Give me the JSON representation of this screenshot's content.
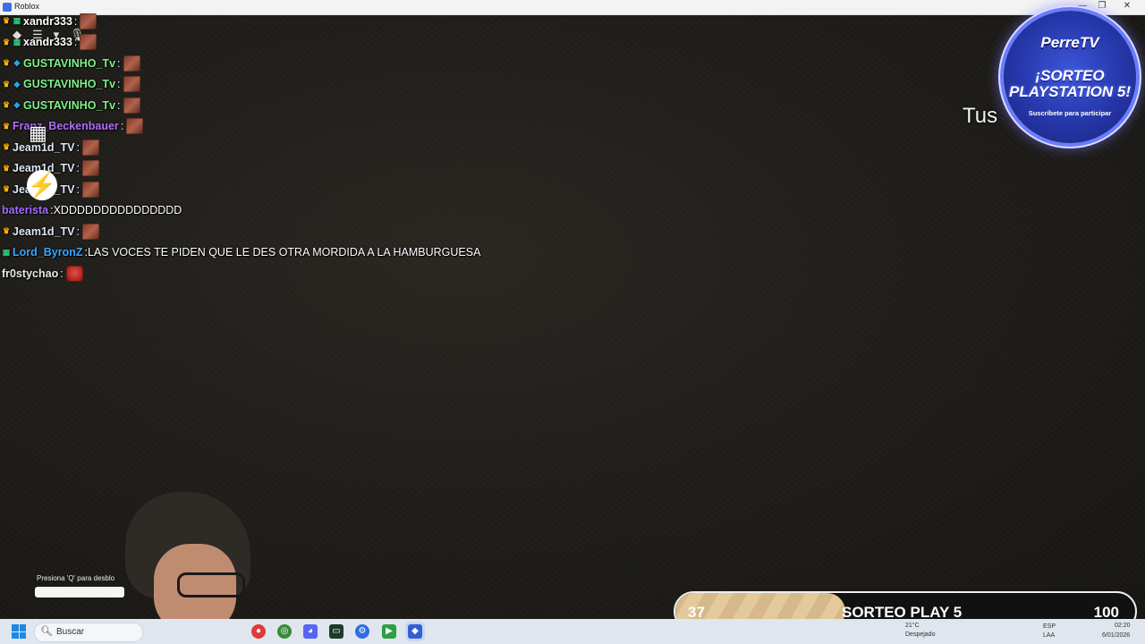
{
  "window": {
    "title": "Roblox",
    "controls": [
      "—",
      "❐",
      "✕"
    ]
  },
  "chat": {
    "messages": [
      {
        "user": "xandr333",
        "color": "#ffffff",
        "badges": [
          "crown",
          "grid"
        ],
        "text": "",
        "emote": "brown"
      },
      {
        "user": "xandr333",
        "color": "#ffffff",
        "badges": [
          "crown",
          "grid"
        ],
        "text": "",
        "emote": "brown"
      },
      {
        "user": "GUSTAVINHO_Tv",
        "color": "#7ef08a",
        "badges": [
          "crown",
          "gem"
        ],
        "text": "",
        "emote": "brown"
      },
      {
        "user": "GUSTAVINHO_Tv",
        "color": "#7ef08a",
        "badges": [
          "crown",
          "gem"
        ],
        "text": "",
        "emote": "brown"
      },
      {
        "user": "GUSTAVINHO_Tv",
        "color": "#7ef08a",
        "badges": [
          "crown",
          "gem"
        ],
        "text": "",
        "emote": "brown"
      },
      {
        "user": "Franz_Beckenbauer",
        "color": "#b46cff",
        "badges": [
          "crown"
        ],
        "text": "",
        "emote": "brown"
      },
      {
        "user": "Jeam1d_TV",
        "color": "#dce6f5",
        "badges": [
          "crown"
        ],
        "text": "",
        "emote": "brown"
      },
      {
        "user": "Jeam1d_TV",
        "color": "#dce6f5",
        "badges": [
          "crown"
        ],
        "text": "",
        "emote": "brown"
      },
      {
        "user": "Jeam1d_TV",
        "color": "#dce6f5",
        "badges": [
          "crown"
        ],
        "text": "",
        "emote": "brown"
      },
      {
        "user": "baterista",
        "color": "#a56bff",
        "badges": [],
        "text": "XDDDDDDDDDDDDDDD",
        "emote": ""
      },
      {
        "user": "Jeam1d_TV",
        "color": "#dce6f5",
        "badges": [
          "crown"
        ],
        "text": "",
        "emote": "brown"
      },
      {
        "user": "Lord_ByronZ",
        "color": "#3aa7ff",
        "badges": [
          "grid"
        ],
        "text": "LAS VOCES TE PIDEN QUE LE DES OTRA MORDIDA A LA HAMBURGUESA",
        "emote": ""
      },
      {
        "user": "fr0stychao",
        "color": "#e8e8e8",
        "badges": [],
        "text": "",
        "emote": "red"
      }
    ]
  },
  "overlay": {
    "tus_text": "Tus",
    "promo": {
      "brand": "PerreTV",
      "line1": "¡SORTEO",
      "line2": "PLAYSTATION 5!",
      "sub": "Suscríbete para participar"
    },
    "prompt_text": "Presiona 'Q' para desblo",
    "progress": {
      "current": "37",
      "label": "SORTEO PLAY 5",
      "goal": "100",
      "fraction": 0.37
    }
  },
  "taskbar": {
    "search_placeholder": "Buscar",
    "weather_temp": "21°C",
    "weather_desc": "Despejado",
    "lang_top": "ESP",
    "lang_bottom": "LAA",
    "time": "02:20",
    "date": "6/01/2026"
  }
}
